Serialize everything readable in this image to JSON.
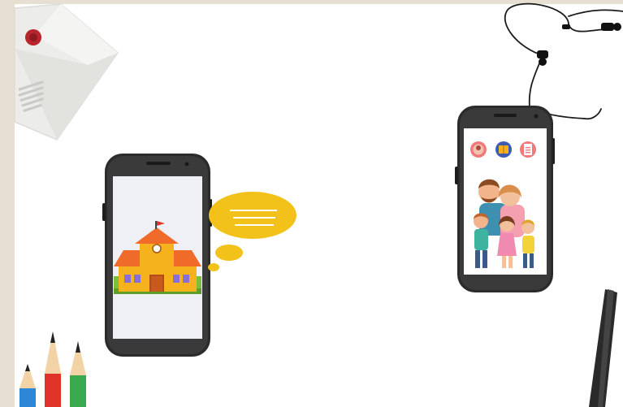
{
  "scene": {
    "colors": {
      "frame_border": "#e6dfd2",
      "canvas": "#ffffff",
      "phone_body": "#2b2b2b",
      "screen": "#eef0f6",
      "bubble": "#f2c21a",
      "school_wall": "#f6b21c",
      "school_roof": "#f06a2a",
      "pencil_blue": "#2d86d8",
      "pencil_red": "#e0342a",
      "pencil_green": "#3aa84e",
      "stylus": "#2a2a2a"
    },
    "icons": {
      "envelope": "envelope-icon",
      "wax_seal": "wax-seal-icon",
      "earphones": "earphones-icon",
      "school": "school-icon",
      "family": "family-icon",
      "speech_bubble": "speech-bubble-icon",
      "app_icons": [
        "profile-app-icon",
        "book-app-icon",
        "document-app-icon"
      ]
    }
  }
}
